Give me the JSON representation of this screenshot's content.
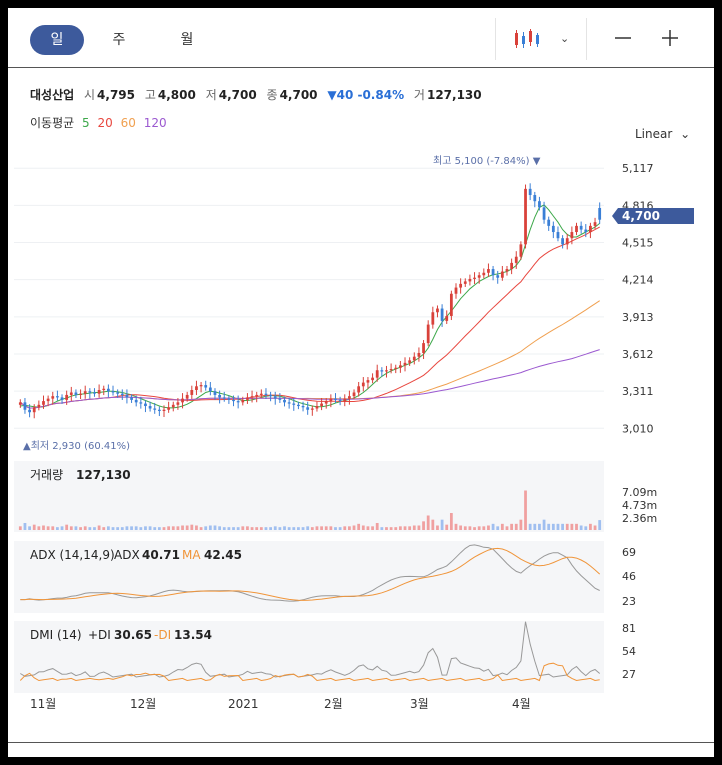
{
  "tabs": [
    {
      "label": "일",
      "active": true
    },
    {
      "label": "주",
      "active": false
    },
    {
      "label": "월",
      "active": false
    }
  ],
  "toolbar": {
    "chart_type_icon": "candlestick-icon",
    "dropdown_icon": "chevron-down-icon",
    "zoom_out_icon": "minus-icon",
    "zoom_in_icon": "plus-icon"
  },
  "quote": {
    "name": "대성산업",
    "open_label": "시",
    "open": "4,795",
    "high_label": "고",
    "high": "4,800",
    "low_label": "저",
    "low": "4,700",
    "close_label": "종",
    "close": "4,700",
    "change": "▼40 -0.84%",
    "volume_label": "거",
    "volume": "127,130"
  },
  "ma_legend": {
    "label": "이동평균",
    "periods": [
      "5",
      "20",
      "60",
      "120"
    ],
    "colors": [
      "#3da84a",
      "#e8473f",
      "#f0a050",
      "#9b59d0"
    ]
  },
  "scale_label": "Linear",
  "colors": {
    "up": "#d9413a",
    "down": "#3a7fd6",
    "price_tag": "#3d5a9c",
    "gray": "#999999",
    "orange": "#f0953a",
    "accent_text": "#5a6fa8"
  },
  "chart_data": [
    {
      "type": "candlestick",
      "x_labels": [
        "11월",
        "12월",
        "2021",
        "2월",
        "3월",
        "4월"
      ],
      "y_ticks": [
        3010,
        3311,
        3612,
        3913,
        4214,
        4515,
        4816,
        5117
      ],
      "ylim": [
        2850,
        5200
      ],
      "high_annotation": "최고 5,100 (-7.84%) ▼",
      "low_annotation": "▲최저 2,930 (60.41%)",
      "current_price": "4,700",
      "close": [
        3220,
        3160,
        3140,
        3180,
        3200,
        3230,
        3250,
        3270,
        3260,
        3240,
        3280,
        3300,
        3280,
        3290,
        3310,
        3300,
        3290,
        3320,
        3330,
        3310,
        3300,
        3290,
        3280,
        3260,
        3240,
        3220,
        3210,
        3190,
        3170,
        3160,
        3150,
        3160,
        3180,
        3200,
        3220,
        3250,
        3280,
        3320,
        3350,
        3360,
        3340,
        3310,
        3280,
        3260,
        3250,
        3240,
        3230,
        3220,
        3240,
        3260,
        3270,
        3280,
        3290,
        3280,
        3270,
        3250,
        3240,
        3220,
        3210,
        3200,
        3190,
        3180,
        3160,
        3170,
        3190,
        3210,
        3230,
        3250,
        3240,
        3230,
        3250,
        3270,
        3300,
        3350,
        3380,
        3400,
        3420,
        3480,
        3470,
        3480,
        3490,
        3500,
        3520,
        3540,
        3560,
        3590,
        3620,
        3700,
        3850,
        3950,
        3980,
        3880,
        3920,
        4100,
        4150,
        4180,
        4200,
        4220,
        4230,
        4250,
        4270,
        4300,
        4250,
        4230,
        4280,
        4300,
        4350,
        4400,
        4500,
        4950,
        4900,
        4850,
        4800,
        4700,
        4650,
        4600,
        4550,
        4500,
        4550,
        4600,
        4650,
        4620,
        4600,
        4650,
        4680,
        4700
      ],
      "open": [
        3200,
        3220,
        3160,
        3140,
        3180,
        3200,
        3230,
        3250,
        3270,
        3260,
        3240,
        3280,
        3300,
        3280,
        3290,
        3310,
        3300,
        3290,
        3320,
        3330,
        3310,
        3300,
        3290,
        3280,
        3260,
        3240,
        3220,
        3210,
        3190,
        3170,
        3160,
        3150,
        3160,
        3180,
        3200,
        3220,
        3250,
        3280,
        3320,
        3350,
        3360,
        3340,
        3310,
        3280,
        3260,
        3250,
        3240,
        3230,
        3220,
        3240,
        3260,
        3270,
        3280,
        3290,
        3280,
        3270,
        3250,
        3240,
        3220,
        3210,
        3200,
        3190,
        3180,
        3160,
        3170,
        3190,
        3210,
        3230,
        3250,
        3240,
        3230,
        3250,
        3270,
        3300,
        3350,
        3380,
        3400,
        3420,
        3480,
        3470,
        3480,
        3490,
        3500,
        3520,
        3540,
        3560,
        3590,
        3620,
        3700,
        3850,
        3950,
        3980,
        3880,
        3920,
        4100,
        4150,
        4180,
        4200,
        4220,
        4230,
        4250,
        4270,
        4300,
        4250,
        4230,
        4280,
        4300,
        4350,
        4400,
        4500,
        4950,
        4900,
        4850,
        4800,
        4700,
        4650,
        4600,
        4550,
        4500,
        4550,
        4600,
        4650,
        4620,
        4600,
        4650,
        4795
      ],
      "ma5": [
        3190,
        3195,
        3190,
        3185,
        3180,
        3185,
        3195,
        3210,
        3230,
        3245,
        3255,
        3270,
        3280,
        3285,
        3290,
        3295,
        3300,
        3300,
        3305,
        3310,
        3310,
        3305,
        3300,
        3290,
        3280,
        3265,
        3250,
        3235,
        3220,
        3205,
        3190,
        3180,
        3175,
        3175,
        3180,
        3190,
        3205,
        3225,
        3250,
        3275,
        3300,
        3310,
        3305,
        3295,
        3285,
        3275,
        3260,
        3245,
        3235,
        3235,
        3240,
        3250,
        3260,
        3270,
        3275,
        3275,
        3270,
        3260,
        3250,
        3235,
        3220,
        3210,
        3200,
        3190,
        3185,
        3185,
        3190,
        3200,
        3215,
        3225,
        3235,
        3245,
        3255,
        3275,
        3300,
        3330,
        3365,
        3400,
        3430,
        3455,
        3475,
        3490,
        3505,
        3520,
        3535,
        3555,
        3580,
        3610,
        3660,
        3730,
        3810,
        3870,
        3915,
        3960,
        4010,
        4060,
        4100,
        4140,
        4170,
        4200,
        4220,
        4240,
        4255,
        4260,
        4270,
        4280,
        4300,
        4330,
        4380,
        4500,
        4620,
        4720,
        4800,
        4820,
        4780,
        4730,
        4680,
        4620,
        4580,
        4560,
        4560,
        4580,
        4600,
        4620,
        4640,
        4670
      ]
    },
    {
      "type": "bar",
      "title": "거래량",
      "value": "127,130",
      "y_ticks": [
        "7.09m",
        "4.73m",
        "2.36m"
      ]
    },
    {
      "type": "line",
      "title": "ADX (14,14,9)",
      "series": [
        {
          "name": "ADX",
          "value": "40.71"
        },
        {
          "name": "MA",
          "value": "42.45"
        }
      ],
      "y_ticks": [
        "69",
        "46",
        "23"
      ]
    },
    {
      "type": "line",
      "title": "DMI (14)",
      "series": [
        {
          "name": "+DI",
          "value": "30.65"
        },
        {
          "name": "-DI",
          "value": "13.54"
        }
      ],
      "y_ticks": [
        "81",
        "54",
        "27"
      ]
    }
  ]
}
